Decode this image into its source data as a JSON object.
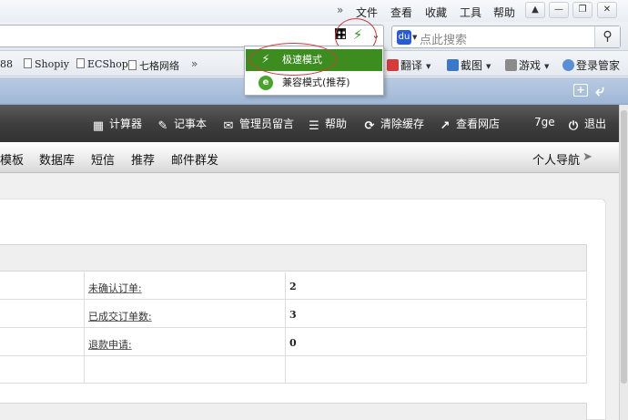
{
  "menubar": {
    "chevron": "»",
    "items": [
      "文件",
      "查看",
      "收藏",
      "工具",
      "帮助"
    ],
    "window_buttons": [
      "shirt",
      "minimize",
      "restore",
      "close"
    ]
  },
  "search": {
    "placeholder": "点此搜索"
  },
  "bookmarks": {
    "items": [
      "88",
      "Shopiy",
      "ECShop",
      "七格网络"
    ],
    "chevron": "»",
    "tools": [
      "翻译",
      "截图",
      "游戏",
      "登录管家"
    ]
  },
  "popup": {
    "options": [
      "极速模式",
      "兼容模式(推荐)"
    ],
    "selected": "极速模式"
  },
  "header": {
    "toolbar": [
      "计算器",
      "记事本",
      "管理员留言",
      "帮助",
      "清除缓存",
      "查看网店",
      "7ge",
      "退出"
    ]
  },
  "nav": {
    "items": [
      "模板",
      "数据库",
      "短信",
      "推荐",
      "邮件群发"
    ],
    "right": "个人导航"
  },
  "orders": {
    "rows": [
      {
        "label": "未确认订单:",
        "value": "2"
      },
      {
        "label": "已成交订单数:",
        "value": "3"
      },
      {
        "label": "退款申请:",
        "value": "0"
      }
    ]
  },
  "colors": {
    "accent_green": "#3c8c20",
    "annotation_red": "#d23b3b",
    "header_dark": "#3f3f3f"
  }
}
